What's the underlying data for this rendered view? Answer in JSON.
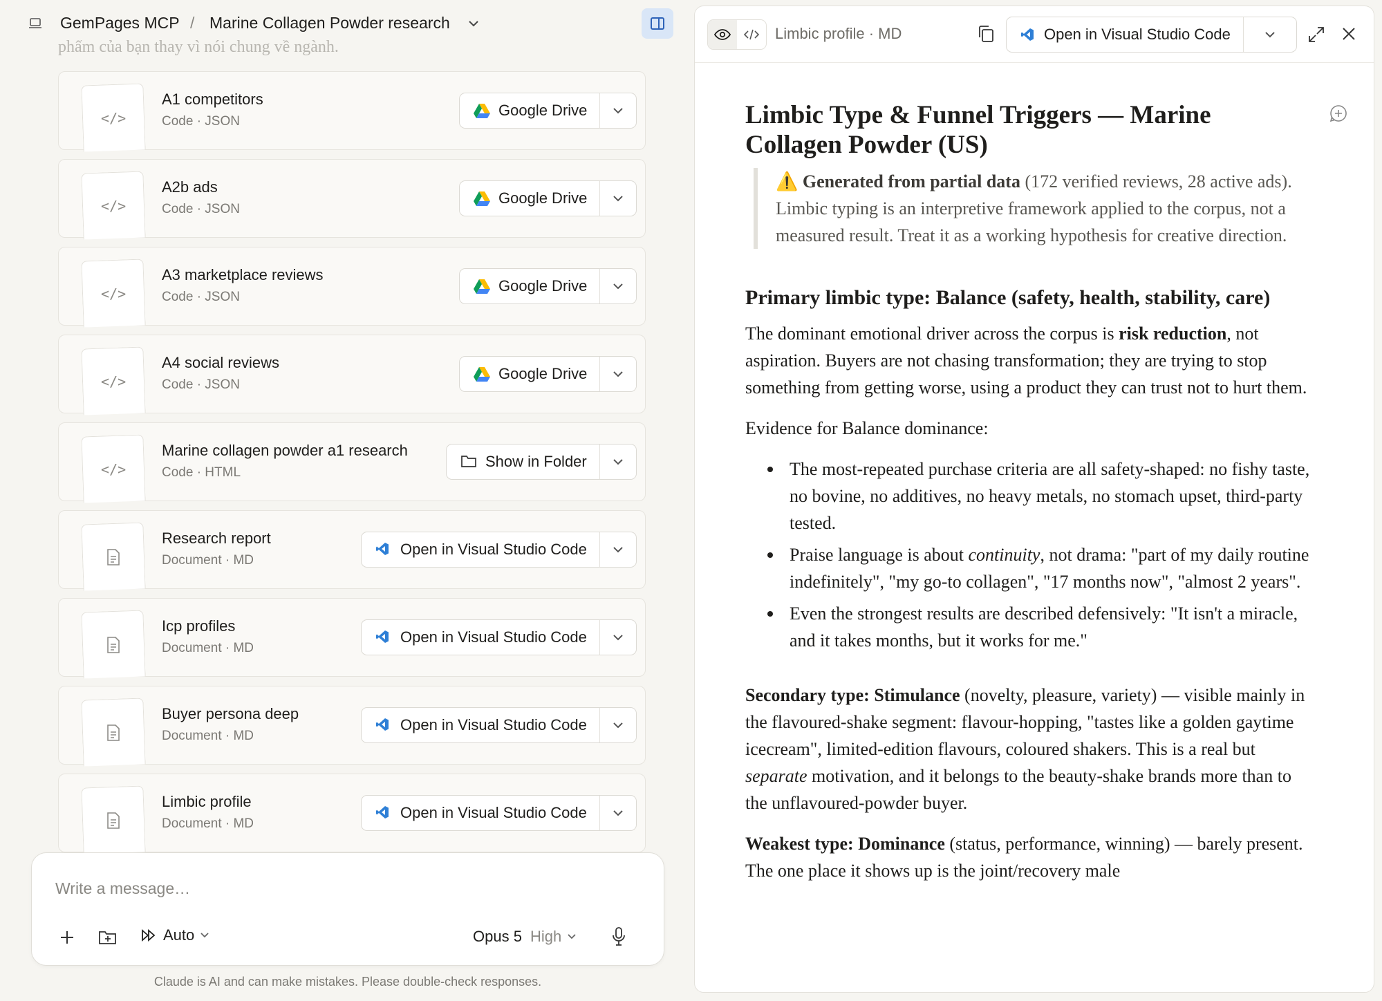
{
  "breadcrumb": {
    "project": "GemPages MCP",
    "separator": "/",
    "chat": "Marine Collagen Powder research"
  },
  "faded_text": "phẩm của bạn thay vì nói chung về ngành.",
  "files": [
    {
      "name": "A1 competitors",
      "meta": "Code · JSON",
      "kind": "code",
      "action": "Google Drive",
      "action_icon": "google-drive-icon"
    },
    {
      "name": "A2b ads",
      "meta": "Code · JSON",
      "kind": "code",
      "action": "Google Drive",
      "action_icon": "google-drive-icon"
    },
    {
      "name": "A3 marketplace reviews",
      "meta": "Code · JSON",
      "kind": "code",
      "action": "Google Drive",
      "action_icon": "google-drive-icon"
    },
    {
      "name": "A4 social reviews",
      "meta": "Code · JSON",
      "kind": "code",
      "action": "Google Drive",
      "action_icon": "google-drive-icon"
    },
    {
      "name": "Marine collagen powder a1 research",
      "meta": "Code · HTML",
      "kind": "code",
      "action": "Show in Folder",
      "action_icon": "folder-icon"
    },
    {
      "name": "Research report",
      "meta": "Document · MD",
      "kind": "doc",
      "action": "Open in Visual Studio Code",
      "action_icon": "vscode-icon"
    },
    {
      "name": "Icp profiles",
      "meta": "Document · MD",
      "kind": "doc",
      "action": "Open in Visual Studio Code",
      "action_icon": "vscode-icon"
    },
    {
      "name": "Buyer persona deep",
      "meta": "Document · MD",
      "kind": "doc",
      "action": "Open in Visual Studio Code",
      "action_icon": "vscode-icon"
    },
    {
      "name": "Limbic profile",
      "meta": "Document · MD",
      "kind": "doc",
      "action": "Open in Visual Studio Code",
      "action_icon": "vscode-icon"
    }
  ],
  "code_glyph": "</>",
  "composer": {
    "placeholder": "Write a message…",
    "mode": "Auto",
    "model": "Opus 5",
    "effort": "High"
  },
  "disclaimer": "Claude is AI and can make mistakes. Please double-check responses.",
  "preview": {
    "title": "Limbic profile · MD",
    "open_label": "Open in Visual Studio Code",
    "doc": {
      "h1": "Limbic Type & Funnel Triggers — Marine Collagen Powder (US)",
      "note_bold": "Generated from partial data",
      "note_rest": " (172 verified reviews, 28 active ads). Limbic typing is an interpretive framework applied to the corpus, not a measured result. Treat it as a working hypothesis for creative direction.",
      "h2": "Primary limbic type: Balance (safety, health, stability, care)",
      "p1_a": "The dominant emotional driver across the corpus is ",
      "p1_bold": "risk reduction",
      "p1_b": ", not aspiration. Buyers are not chasing transformation; they are trying to stop something from getting worse, using a product they can trust not to hurt them.",
      "p2": "Evidence for Balance dominance:",
      "bullet1": "The most-repeated purchase criteria are all safety-shaped: no fishy taste, no bovine, no additives, no heavy metals, no stomach upset, third-party tested.",
      "bullet2_a": "Praise language is about ",
      "bullet2_em": "continuity",
      "bullet2_b": ", not drama: \"part of my daily routine indefinitely\", \"my go-to collagen\", \"17 months now\", \"almost 2 years\".",
      "bullet3": "Even the strongest results are described defensively: \"It isn't a miracle, and it takes months, but it works for me.\"",
      "p3_bold": "Secondary type: Stimulance",
      "p3_a": " (novelty, pleasure, variety) — visible mainly in the flavoured-shake segment: flavour-hopping, \"tastes like a golden gaytime icecream\", limited-edition flavours, coloured shakers. This is a real but ",
      "p3_em": "separate",
      "p3_b": " motivation, and it belongs to the beauty-shake brands more than to the unflavoured-powder buyer.",
      "p4_bold": "Weakest type: Dominance",
      "p4_a": " (status, performance, winning) — barely present. The one place it shows up is the joint/recovery male"
    }
  },
  "colors": {
    "accent_blue": "#2e63b8",
    "toggle_bg": "#d9e6f7",
    "page_bg": "#f6f5f1",
    "warning": "#f2b900"
  }
}
